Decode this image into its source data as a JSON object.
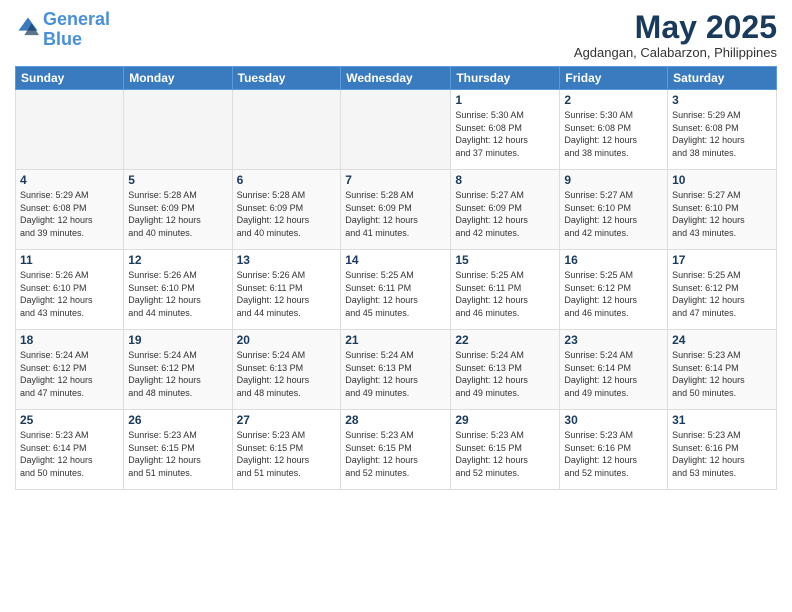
{
  "header": {
    "logo_line1": "General",
    "logo_line2": "Blue",
    "month_year": "May 2025",
    "location": "Agdangan, Calabarzon, Philippines"
  },
  "weekdays": [
    "Sunday",
    "Monday",
    "Tuesday",
    "Wednesday",
    "Thursday",
    "Friday",
    "Saturday"
  ],
  "weeks": [
    [
      {
        "day": "",
        "info": ""
      },
      {
        "day": "",
        "info": ""
      },
      {
        "day": "",
        "info": ""
      },
      {
        "day": "",
        "info": ""
      },
      {
        "day": "1",
        "info": "Sunrise: 5:30 AM\nSunset: 6:08 PM\nDaylight: 12 hours\nand 37 minutes."
      },
      {
        "day": "2",
        "info": "Sunrise: 5:30 AM\nSunset: 6:08 PM\nDaylight: 12 hours\nand 38 minutes."
      },
      {
        "day": "3",
        "info": "Sunrise: 5:29 AM\nSunset: 6:08 PM\nDaylight: 12 hours\nand 38 minutes."
      }
    ],
    [
      {
        "day": "4",
        "info": "Sunrise: 5:29 AM\nSunset: 6:08 PM\nDaylight: 12 hours\nand 39 minutes."
      },
      {
        "day": "5",
        "info": "Sunrise: 5:28 AM\nSunset: 6:09 PM\nDaylight: 12 hours\nand 40 minutes."
      },
      {
        "day": "6",
        "info": "Sunrise: 5:28 AM\nSunset: 6:09 PM\nDaylight: 12 hours\nand 40 minutes."
      },
      {
        "day": "7",
        "info": "Sunrise: 5:28 AM\nSunset: 6:09 PM\nDaylight: 12 hours\nand 41 minutes."
      },
      {
        "day": "8",
        "info": "Sunrise: 5:27 AM\nSunset: 6:09 PM\nDaylight: 12 hours\nand 42 minutes."
      },
      {
        "day": "9",
        "info": "Sunrise: 5:27 AM\nSunset: 6:10 PM\nDaylight: 12 hours\nand 42 minutes."
      },
      {
        "day": "10",
        "info": "Sunrise: 5:27 AM\nSunset: 6:10 PM\nDaylight: 12 hours\nand 43 minutes."
      }
    ],
    [
      {
        "day": "11",
        "info": "Sunrise: 5:26 AM\nSunset: 6:10 PM\nDaylight: 12 hours\nand 43 minutes."
      },
      {
        "day": "12",
        "info": "Sunrise: 5:26 AM\nSunset: 6:10 PM\nDaylight: 12 hours\nand 44 minutes."
      },
      {
        "day": "13",
        "info": "Sunrise: 5:26 AM\nSunset: 6:11 PM\nDaylight: 12 hours\nand 44 minutes."
      },
      {
        "day": "14",
        "info": "Sunrise: 5:25 AM\nSunset: 6:11 PM\nDaylight: 12 hours\nand 45 minutes."
      },
      {
        "day": "15",
        "info": "Sunrise: 5:25 AM\nSunset: 6:11 PM\nDaylight: 12 hours\nand 46 minutes."
      },
      {
        "day": "16",
        "info": "Sunrise: 5:25 AM\nSunset: 6:12 PM\nDaylight: 12 hours\nand 46 minutes."
      },
      {
        "day": "17",
        "info": "Sunrise: 5:25 AM\nSunset: 6:12 PM\nDaylight: 12 hours\nand 47 minutes."
      }
    ],
    [
      {
        "day": "18",
        "info": "Sunrise: 5:24 AM\nSunset: 6:12 PM\nDaylight: 12 hours\nand 47 minutes."
      },
      {
        "day": "19",
        "info": "Sunrise: 5:24 AM\nSunset: 6:12 PM\nDaylight: 12 hours\nand 48 minutes."
      },
      {
        "day": "20",
        "info": "Sunrise: 5:24 AM\nSunset: 6:13 PM\nDaylight: 12 hours\nand 48 minutes."
      },
      {
        "day": "21",
        "info": "Sunrise: 5:24 AM\nSunset: 6:13 PM\nDaylight: 12 hours\nand 49 minutes."
      },
      {
        "day": "22",
        "info": "Sunrise: 5:24 AM\nSunset: 6:13 PM\nDaylight: 12 hours\nand 49 minutes."
      },
      {
        "day": "23",
        "info": "Sunrise: 5:24 AM\nSunset: 6:14 PM\nDaylight: 12 hours\nand 49 minutes."
      },
      {
        "day": "24",
        "info": "Sunrise: 5:23 AM\nSunset: 6:14 PM\nDaylight: 12 hours\nand 50 minutes."
      }
    ],
    [
      {
        "day": "25",
        "info": "Sunrise: 5:23 AM\nSunset: 6:14 PM\nDaylight: 12 hours\nand 50 minutes."
      },
      {
        "day": "26",
        "info": "Sunrise: 5:23 AM\nSunset: 6:15 PM\nDaylight: 12 hours\nand 51 minutes."
      },
      {
        "day": "27",
        "info": "Sunrise: 5:23 AM\nSunset: 6:15 PM\nDaylight: 12 hours\nand 51 minutes."
      },
      {
        "day": "28",
        "info": "Sunrise: 5:23 AM\nSunset: 6:15 PM\nDaylight: 12 hours\nand 52 minutes."
      },
      {
        "day": "29",
        "info": "Sunrise: 5:23 AM\nSunset: 6:15 PM\nDaylight: 12 hours\nand 52 minutes."
      },
      {
        "day": "30",
        "info": "Sunrise: 5:23 AM\nSunset: 6:16 PM\nDaylight: 12 hours\nand 52 minutes."
      },
      {
        "day": "31",
        "info": "Sunrise: 5:23 AM\nSunset: 6:16 PM\nDaylight: 12 hours\nand 53 minutes."
      }
    ]
  ]
}
